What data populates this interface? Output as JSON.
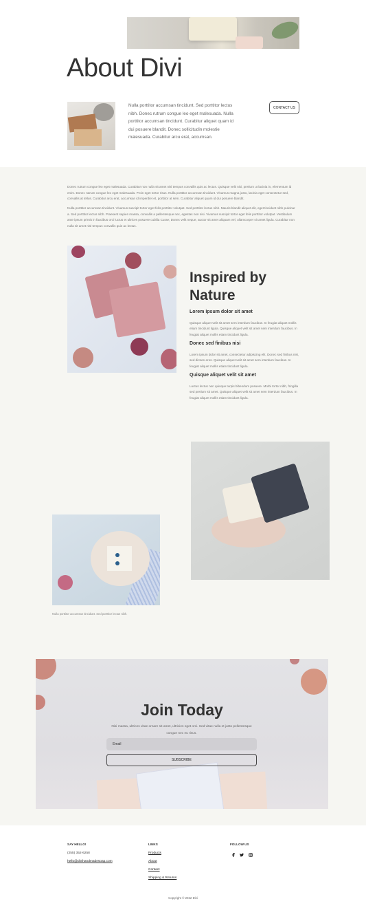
{
  "hero": {
    "title": "About Divi",
    "intro_text": "Nulla porttitor accumsan tincidunt. Sed porttitor lectus nibh. Donec rutrum congue leo eget malesuada. Nulla porttitor accumsan tincidunt. Curabitur aliquet quam id dui posuere blandit. Donec sollicitudin molestie malesuada. Curabitur arcu erat, accumsan.",
    "contact_label": "CONTACT US"
  },
  "about": {
    "paragraph1": "Donec rutrum congue leo eget malesuada. Curabitur non nulla sit amet nisl tempus convallis quis ac lectus. Quisque velit nisi, pretium ut lacinia in, elementum id enim. Donec rutrum congue leo eget malesuada. Proin eget tortor risus. Nulla porttitor accumsan tincidunt. Vivamus magna justo, lacinia eget consectetur sed, convallis at tellus. Curabitur arcu erat, accumsan id imperdiet et, porttitor at sem. Curabitur aliquet quam id dui posuere blandit.",
    "paragraph2": "Nulla porttitor accumsan tincidunt. Vivamus suscipit tortor eget felis porttitor volutpat. Sed porttitor lectus nibh. Mauris blandit aliquet elit, eget tincidunt nibh pulvinar a. Sed porttitor lectus nibh. Praesent sapien massa, convallis a pellentesque nec, egestas non nisi. Vivamus suscipit tortor eget felis porttitor volutpat. Vestibulum ante ipsum primis in faucibus orci luctus et ultrices posuere cubilia Curae; Donec velit neque, auctor sit amet aliquam vel, ullamcorper sit amet ligula. Curabitur non nulla sit amet nisl tempus convallis quis ac lectus."
  },
  "inspired": {
    "title_line1": "Inspired by",
    "title_line2": "Nature",
    "items": [
      {
        "heading": "Lorem ipsum dolor sit amet",
        "text": "Quisque aliquet velit sit amet sem interdum faucibus. In feugiat aliquet mollis etiam tincidunt ligula. Quisque aliquet velit sit amet sem interdum faucibus. In feugiat aliquet mollis etiam tincidunt ligula."
      },
      {
        "heading": "Donec sed finibus nisi",
        "text": "Lorem ipsum dolor sit amet, consectetur adipiscing elit. Donec sed finibus nisi, sed dictum eros. Quisque aliquet velit sit amet sem interdum faucibus. In feugiat aliquet mollis etiam tincidunt ligula."
      },
      {
        "heading": "Quisque aliquet velit sit amet",
        "text": "Luctus lectus non quisque turpis bibendum posuere. Morbi tortor nibh, fringilla sed pretium sit amet. Quisque aliquet velit sit amet sem interdum faucibus. In feugiat aliquet mollis etiam tincidunt ligula."
      }
    ]
  },
  "gallery": {
    "caption": "Nulla porttitor accumsan tincidunt. Sed porttitor lectus nibh."
  },
  "join": {
    "title": "Join Today",
    "text": "Nisi massa, ultrices vitae ornare sit amet, ultricies eget orci. Sed vitae nulla et justo pellentesque congue nec eu risus.",
    "email_placeholder": "Email",
    "subscribe_label": "SUBSCRIBE"
  },
  "footer": {
    "col1_heading": "SAY HELLO!",
    "phone": "(255) 352-6258",
    "email": "hello@divihandmadesoap.com",
    "col2_heading": "LINKS",
    "links": [
      "Products",
      "About",
      "Contact",
      "Shipping & Returns"
    ],
    "col3_heading": "FOLLOW US",
    "social_icons": [
      "facebook-icon",
      "twitter-icon",
      "instagram-icon"
    ],
    "copyright": "Copyright © 2022 Divi"
  }
}
